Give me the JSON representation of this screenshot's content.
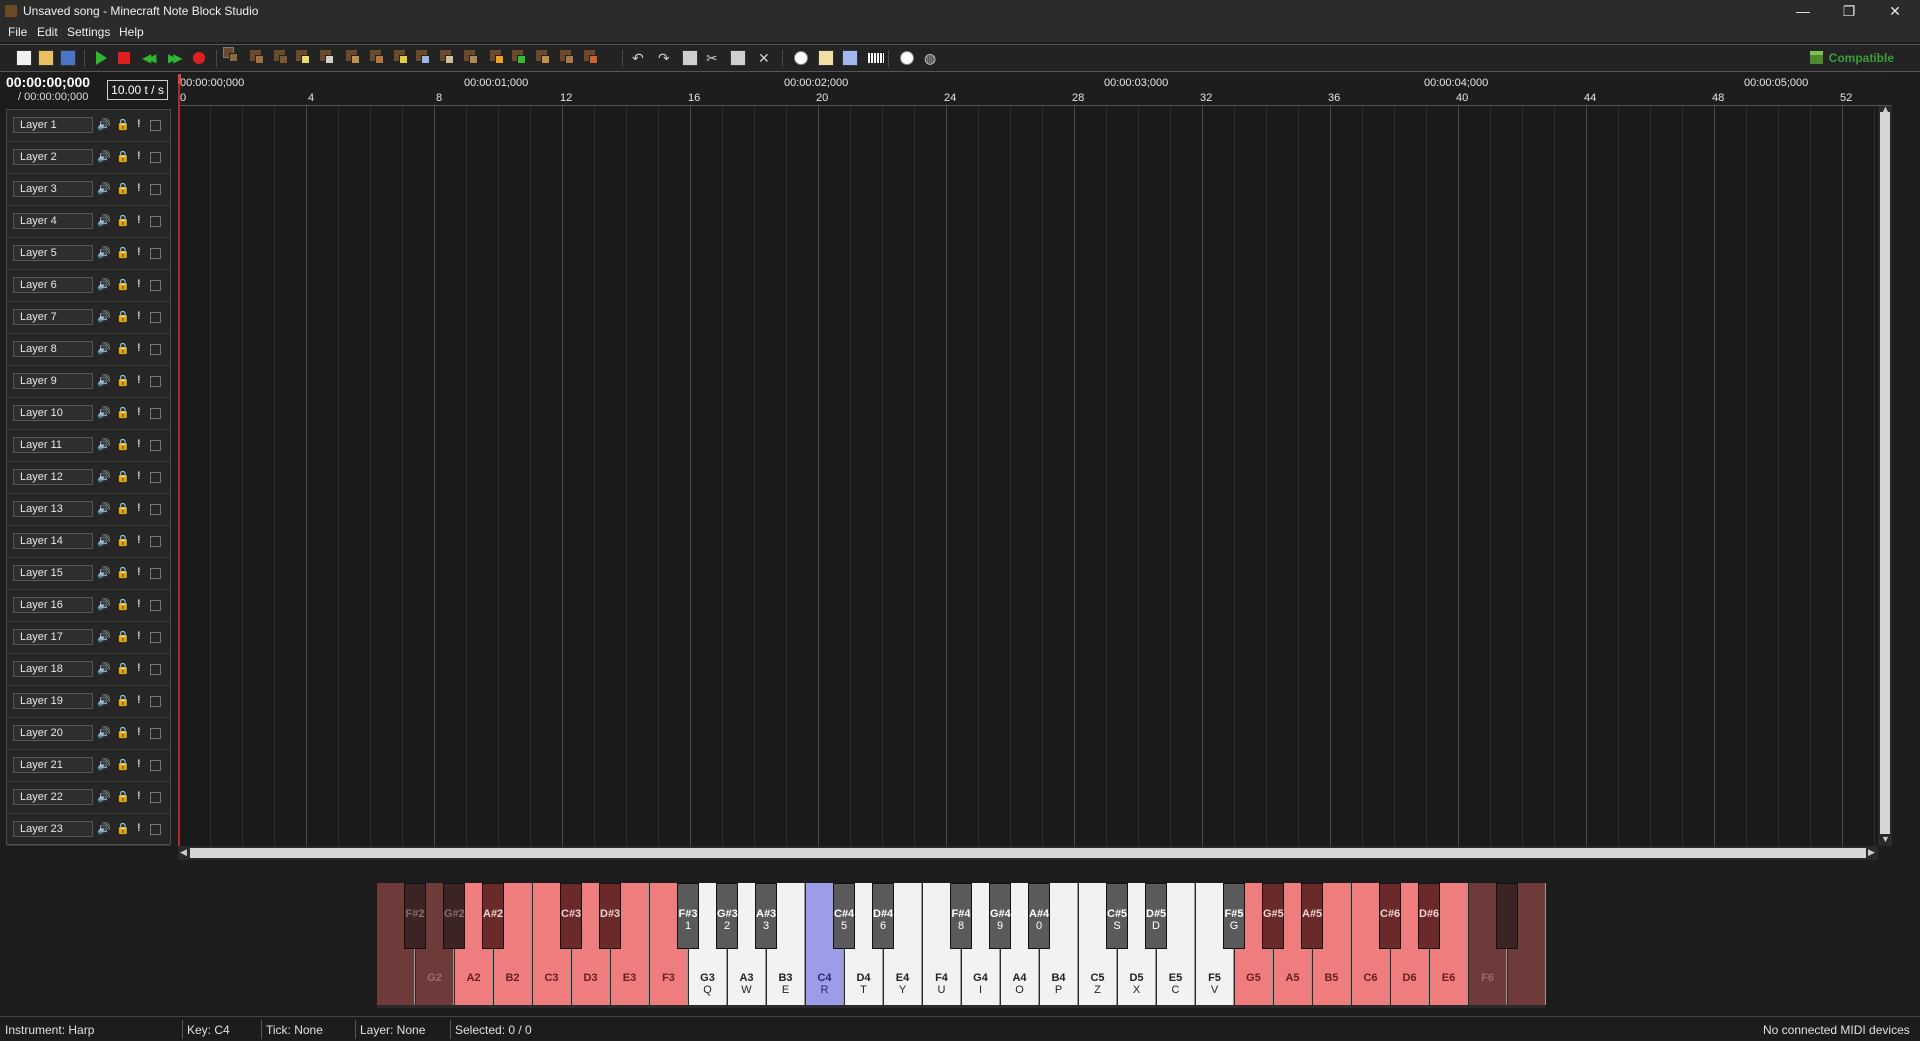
{
  "window": {
    "title": "Unsaved song - Minecraft Note Block Studio",
    "minimize": "—",
    "maximize": "❐",
    "close": "✕"
  },
  "menu": [
    "File",
    "Edit",
    "Settings",
    "Help"
  ],
  "toolbar": {
    "compatible_label": "Compatible",
    "tools": [
      "new-file",
      "open-file",
      "save-file",
      "play",
      "stop",
      "rewind",
      "fast-forward",
      "record",
      "instrument-harp",
      "instrument-double-bass",
      "instrument-bass-drum",
      "instrument-snare",
      "instrument-click",
      "instrument-guitar",
      "instrument-flute",
      "instrument-bell",
      "instrument-chime",
      "instrument-xylophone",
      "instrument-iron-xylophone",
      "instrument-cow-bell",
      "instrument-didgeridoo",
      "instrument-bit",
      "instrument-banjo",
      "instrument-pling",
      "undo",
      "redo",
      "copy",
      "cut",
      "paste",
      "delete",
      "song-info",
      "song-properties",
      "instrument-settings",
      "midi-devices",
      "preferences",
      "website"
    ]
  },
  "time": {
    "current": "00:00:00;000",
    "total": "/ 00:00:00;000",
    "tempo": "10.00 t / s"
  },
  "ruler": {
    "times": [
      "00:00:00;000",
      "00:00:01;000",
      "00:00:02;000",
      "00:00:03;000",
      "00:00:04;000",
      "00:00:05;000"
    ],
    "ticks": [
      "0",
      "4",
      "8",
      "12",
      "16",
      "20",
      "24",
      "28",
      "32",
      "36",
      "40",
      "44",
      "48",
      "52"
    ]
  },
  "layers": [
    "Layer 1",
    "Layer 2",
    "Layer 3",
    "Layer 4",
    "Layer 5",
    "Layer 6",
    "Layer 7",
    "Layer 8",
    "Layer 9",
    "Layer 10",
    "Layer 11",
    "Layer 12",
    "Layer 13",
    "Layer 14",
    "Layer 15",
    "Layer 16",
    "Layer 17",
    "Layer 18",
    "Layer 19",
    "Layer 20",
    "Layer 21",
    "Layer 22",
    "Layer 23"
  ],
  "layer_icons": {
    "volume": "🔊",
    "lock": "🔒",
    "solo": "!"
  },
  "piano": {
    "white_keys": [
      {
        "note": "",
        "kb": "",
        "state": "dark-red"
      },
      {
        "note": "G2",
        "kb": "",
        "state": "dark-red"
      },
      {
        "note": "A2",
        "kb": "",
        "state": "red"
      },
      {
        "note": "B2",
        "kb": "",
        "state": "red"
      },
      {
        "note": "C3",
        "kb": "",
        "state": "red"
      },
      {
        "note": "D3",
        "kb": "",
        "state": "red"
      },
      {
        "note": "E3",
        "kb": "",
        "state": "red"
      },
      {
        "note": "F3",
        "kb": "",
        "state": "red"
      },
      {
        "note": "G3",
        "kb": "Q",
        "state": "white"
      },
      {
        "note": "A3",
        "kb": "W",
        "state": "white"
      },
      {
        "note": "B3",
        "kb": "E",
        "state": "white"
      },
      {
        "note": "C4",
        "kb": "R",
        "state": "selected"
      },
      {
        "note": "D4",
        "kb": "T",
        "state": "white"
      },
      {
        "note": "E4",
        "kb": "Y",
        "state": "white"
      },
      {
        "note": "F4",
        "kb": "U",
        "state": "white"
      },
      {
        "note": "G4",
        "kb": "I",
        "state": "white"
      },
      {
        "note": "A4",
        "kb": "O",
        "state": "white"
      },
      {
        "note": "B4",
        "kb": "P",
        "state": "white"
      },
      {
        "note": "C5",
        "kb": "Z",
        "state": "white"
      },
      {
        "note": "D5",
        "kb": "X",
        "state": "white"
      },
      {
        "note": "E5",
        "kb": "C",
        "state": "white"
      },
      {
        "note": "F5",
        "kb": "V",
        "state": "white"
      },
      {
        "note": "G5",
        "kb": "",
        "state": "red"
      },
      {
        "note": "A5",
        "kb": "",
        "state": "red"
      },
      {
        "note": "B5",
        "kb": "",
        "state": "red"
      },
      {
        "note": "C6",
        "kb": "",
        "state": "red"
      },
      {
        "note": "D6",
        "kb": "",
        "state": "red"
      },
      {
        "note": "E6",
        "kb": "",
        "state": "red"
      },
      {
        "note": "F6",
        "kb": "",
        "state": "dark-red"
      },
      {
        "note": "",
        "kb": "",
        "state": "dark-red"
      }
    ],
    "black_keys": [
      {
        "note": "F#2",
        "kb": "",
        "state": "dark-red",
        "after": 0
      },
      {
        "note": "G#2",
        "kb": "",
        "state": "dark-red",
        "after": 1
      },
      {
        "note": "A#2",
        "kb": "",
        "state": "red",
        "after": 2
      },
      {
        "note": "C#3",
        "kb": "",
        "state": "red",
        "after": 4
      },
      {
        "note": "D#3",
        "kb": "",
        "state": "red",
        "after": 5
      },
      {
        "note": "F#3",
        "kb": "1",
        "state": "black",
        "after": 7
      },
      {
        "note": "G#3",
        "kb": "2",
        "state": "black",
        "after": 8
      },
      {
        "note": "A#3",
        "kb": "3",
        "state": "black",
        "after": 9
      },
      {
        "note": "C#4",
        "kb": "5",
        "state": "black",
        "after": 11
      },
      {
        "note": "D#4",
        "kb": "6",
        "state": "black",
        "after": 12
      },
      {
        "note": "F#4",
        "kb": "8",
        "state": "black",
        "after": 14
      },
      {
        "note": "G#4",
        "kb": "9",
        "state": "black",
        "after": 15
      },
      {
        "note": "A#4",
        "kb": "0",
        "state": "black",
        "after": 16
      },
      {
        "note": "C#5",
        "kb": "S",
        "state": "black",
        "after": 18
      },
      {
        "note": "D#5",
        "kb": "D",
        "state": "black",
        "after": 19
      },
      {
        "note": "F#5",
        "kb": "G",
        "state": "black",
        "after": 21
      },
      {
        "note": "G#5",
        "kb": "",
        "state": "red",
        "after": 22
      },
      {
        "note": "A#5",
        "kb": "",
        "state": "red",
        "after": 23
      },
      {
        "note": "C#6",
        "kb": "",
        "state": "red",
        "after": 25
      },
      {
        "note": "D#6",
        "kb": "",
        "state": "red",
        "after": 26
      },
      {
        "note": "",
        "kb": "",
        "state": "dark-red",
        "after": 28
      }
    ]
  },
  "status": {
    "instrument": "Instrument: Harp",
    "key": "Key: C4",
    "tick": "Tick: None",
    "layer": "Layer: None",
    "selected": "Selected: 0 / 0",
    "midi": "No connected MIDI devices"
  },
  "colors": {
    "key_red": "#ef7d7d",
    "key_red_text": "#6a1e1e",
    "key_dark_red": "#6e3a3a",
    "key_dark_red_text": "#9b6b6b",
    "key_white": "#f2f2f2",
    "key_selected": "#9d9ce8",
    "black_red": "#6a2a2a",
    "black_dark_red": "#3d2424",
    "black_normal": "#5a5a5a",
    "accent_green": "#3a9c3a",
    "playhead": "#b02a2a"
  }
}
